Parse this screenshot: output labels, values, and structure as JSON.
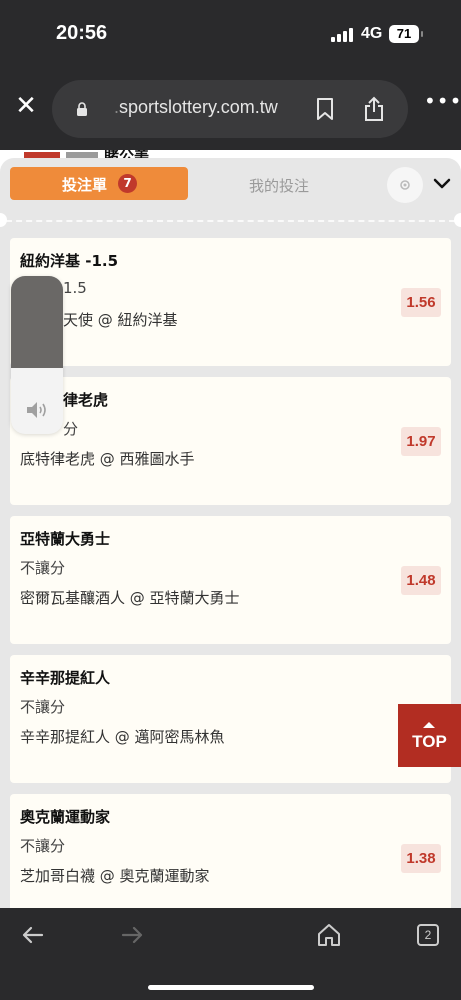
{
  "status_bar": {
    "time": "20:56",
    "network": "4G",
    "battery": "71"
  },
  "browser": {
    "url_prefix": ".",
    "url_domain": "sportslottery.com.tw",
    "close_icon": "close-icon",
    "lock_icon": "lock-icon",
    "bookmark_icon": "bookmark-icon",
    "share_icon": "share-icon",
    "more_icon": "more-icon"
  },
  "background_row": {
    "team_label": "賭公美"
  },
  "bet_slip": {
    "tab_active_label": "投注單",
    "tab_badge": "7",
    "tab_mine_label": "我的投注",
    "items": [
      {
        "team": "紐約洋基 -1.5",
        "bet_type": "1.5",
        "match": "天使 @ 紐約洋基",
        "odds": "1.56"
      },
      {
        "team": "律老虎",
        "bet_type": "分",
        "match": "底特律老虎 @ 西雅圖水手",
        "odds": "1.97"
      },
      {
        "team": "亞特蘭大勇士",
        "bet_type": "不讓分",
        "match": "密爾瓦基釀酒人 @ 亞特蘭大勇士",
        "odds": "1.48"
      },
      {
        "team": "辛辛那提紅人",
        "bet_type": "不讓分",
        "match": "辛辛那提紅人 @ 邁阿密馬林魚",
        "odds": ""
      },
      {
        "team": "奧克蘭運動家",
        "bet_type": "不讓分",
        "match": "芝加哥白襪 @ 奧克蘭運動家",
        "odds": "1.38"
      }
    ]
  },
  "volume": {
    "level": 0.42,
    "icon": "speaker-icon"
  },
  "top_button": {
    "label": "TOP"
  },
  "toolbar": {
    "tabs_count": "2",
    "back_icon": "back-arrow-icon",
    "forward_icon": "forward-arrow-icon",
    "home_icon": "home-icon",
    "tabs_icon": "tabs-icon"
  },
  "colors": {
    "accent_orange": "#ef8b3a",
    "odds_red": "#c0392b",
    "top_button_red": "#b22d22"
  }
}
